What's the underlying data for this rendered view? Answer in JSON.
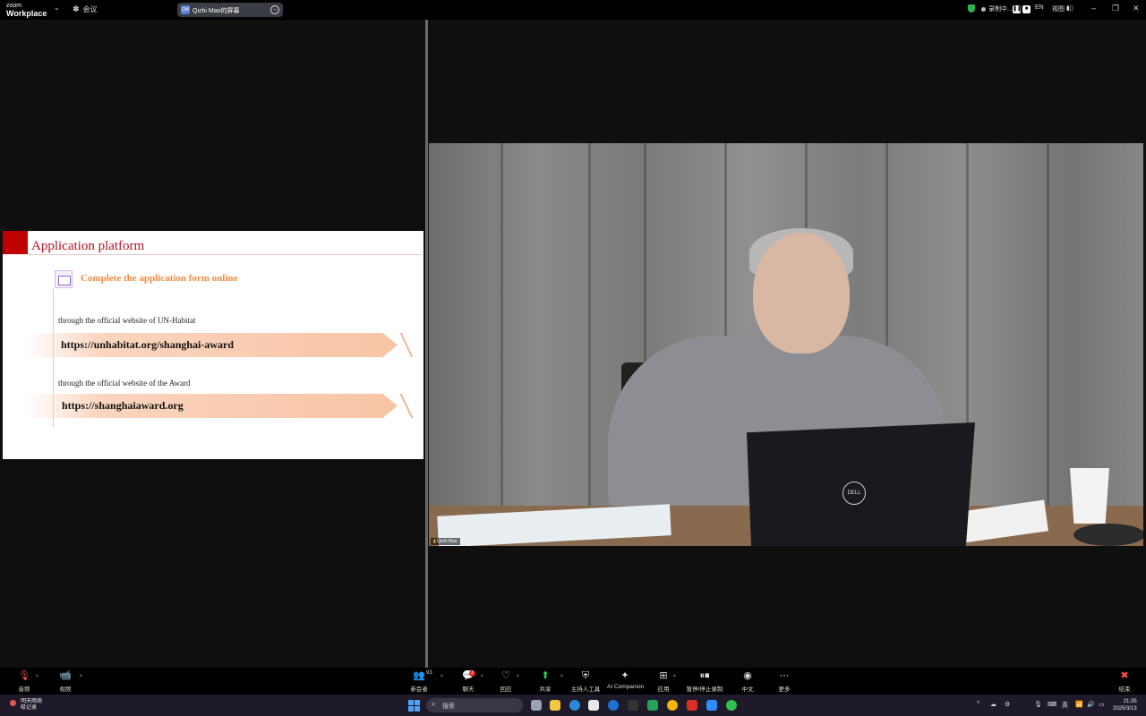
{
  "topbar": {
    "logo_small": "zoom",
    "logo_big": "Workplace",
    "meeting_label": "会议",
    "share_label": "Qizhi Mao的屏幕",
    "share_badge": "QM",
    "recording_label": "录制中...",
    "language": "EN",
    "view_label": "视图"
  },
  "slide": {
    "title": "Application platform",
    "subtitle": "Complete the application form online",
    "label1": "through the official website of UN-Habitat",
    "url1": "https://unhabitat.org/shanghai-award",
    "label2": "through the official website of the Award",
    "url2": "https://shanghaiaward.org"
  },
  "video": {
    "participant_name": "Qizhi Mao",
    "laptop_logo": "DELL"
  },
  "toolbar": {
    "audio": "音频",
    "video": "视频",
    "participants": "参会者",
    "participants_count": "93",
    "chat": "聊天",
    "chat_badge": "3",
    "react": "回应",
    "share": "共享",
    "host_tools": "主持人工具",
    "ai_companion": "AI Companion",
    "apps": "应用",
    "pause_stop_recording": "暂停/停止录制",
    "language": "中文",
    "more": "更多",
    "end": "结束"
  },
  "taskbar": {
    "weather_line1": "明天雨周",
    "weather_line2": "吸记录",
    "search_placeholder": "搜索",
    "ime": "英",
    "time": "21:35",
    "date": "2025/3/13"
  },
  "colors": {
    "slide_red": "#c00000",
    "subtitle_orange": "#f08a3e",
    "share_green": "#2fb24c"
  }
}
